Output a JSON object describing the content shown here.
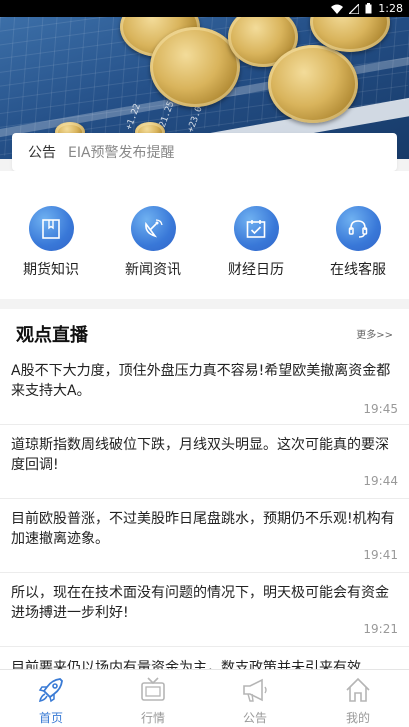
{
  "status_bar": {
    "time": "1:28"
  },
  "notice": {
    "label": "公告",
    "text": "EIA预警发布提醒"
  },
  "menu": [
    {
      "label": "期货知识",
      "icon": "book-icon"
    },
    {
      "label": "新闻资讯",
      "icon": "satellite-icon"
    },
    {
      "label": "财经日历",
      "icon": "calendar-icon"
    },
    {
      "label": "在线客服",
      "icon": "headset-icon"
    }
  ],
  "viewpoint": {
    "title": "观点直播",
    "more": "更多>>",
    "items": [
      {
        "title": "A股不下大力度，顶住外盘压力真不容易!希望欧美撤离资金都来支持大A。",
        "time": "19:45"
      },
      {
        "title": "道琼斯指数周线破位下跌，月线双头明显。这次可能真的要深度回调!",
        "time": "19:44"
      },
      {
        "title": "目前欧股普涨，不过美股昨日尾盘跳水，预期仍不乐观!机构有加速撤离迹象。",
        "time": "19:41"
      },
      {
        "title": "所以，现在在技术面没有问题的情况下，明天极可能会有资金进场搏进一步利好!",
        "time": "19:21"
      },
      {
        "title": "目前要来仍以场内有量资金为主，数支政策并未引来有效",
        "time": ""
      }
    ]
  },
  "tabbar": [
    {
      "label": "首页",
      "icon": "rocket-icon",
      "active": true
    },
    {
      "label": "行情",
      "icon": "tv-icon",
      "active": false
    },
    {
      "label": "公告",
      "icon": "megaphone-icon",
      "active": false
    },
    {
      "label": "我的",
      "icon": "home-icon",
      "active": false
    }
  ],
  "colors": {
    "accent": "#3a7bd5",
    "icon_blue": "#3978d8"
  }
}
